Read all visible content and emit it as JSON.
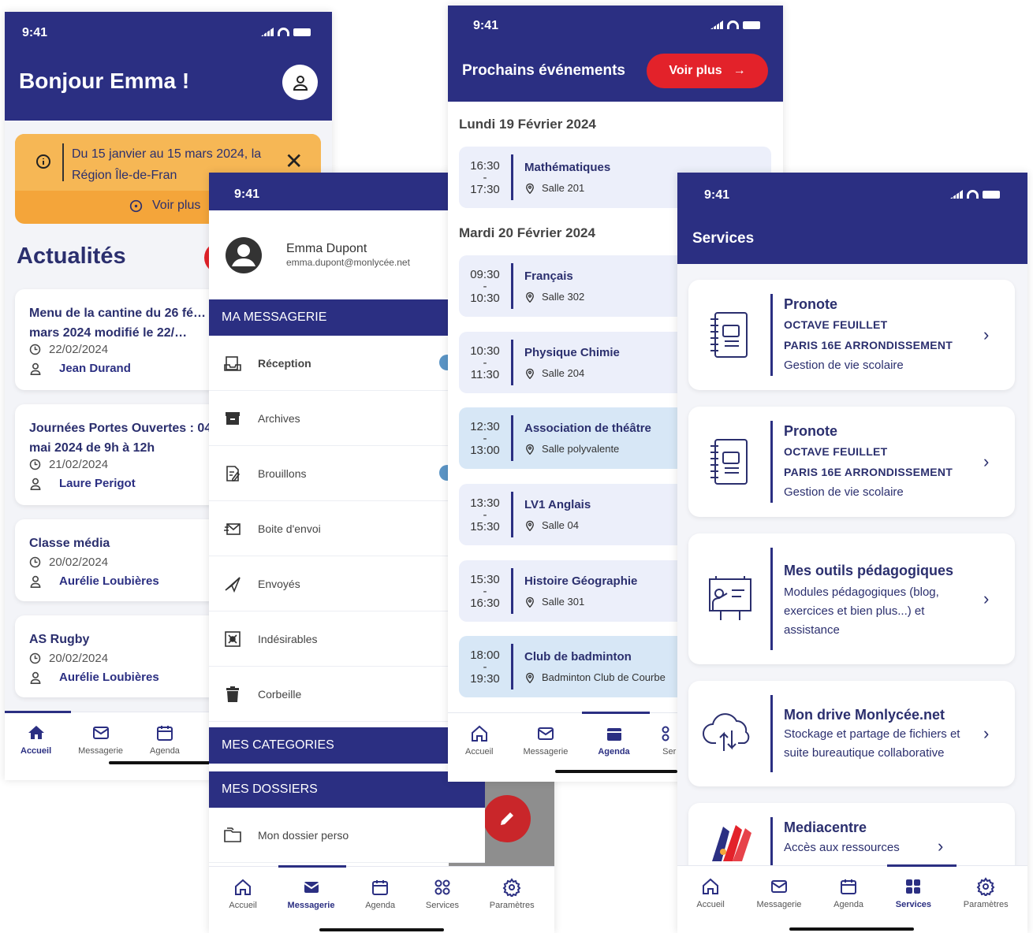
{
  "status": {
    "time": "9:41"
  },
  "home": {
    "greeting": "Bonjour Emma !",
    "banner": {
      "text": "Du 15 janvier au 15 mars 2024, la Région Île-de-Fran",
      "link": "Voir plus"
    },
    "section_title": "Actualités",
    "news": [
      {
        "title": "Menu de la cantine du 26 fé… mars 2024 modifié le 22/…",
        "date": "22/02/2024",
        "author": "Jean Durand"
      },
      {
        "title": "Journées Portes Ouvertes : 04 mai 2024 de 9h à 12h",
        "date": "21/02/2024",
        "author": "Laure Perigot"
      },
      {
        "title": "Classe média",
        "date": "20/02/2024",
        "author": "Aurélie Loubières"
      },
      {
        "title": "AS Rugby",
        "date": "20/02/2024",
        "author": "Aurélie Loubières"
      }
    ],
    "tabs": [
      "Accueil",
      "Messagerie",
      "Agenda"
    ]
  },
  "mail": {
    "user_name": "Emma Dupont",
    "user_email": "emma.dupont@monlycée.net",
    "section_inbox": "MA MESSAGERIE",
    "folders": [
      "Réception",
      "Archives",
      "Brouillons",
      "Boite d'envoi",
      "Envoyés",
      "Indésirables",
      "Corbeille"
    ],
    "section_categories": "MES CATEGORIES",
    "section_folders": "MES DOSSIERS",
    "personal_folder": "Mon dossier perso",
    "tabs": [
      "Accueil",
      "Messagerie",
      "Agenda",
      "Services",
      "Paramètres"
    ]
  },
  "agenda": {
    "title": "Prochains événements",
    "more_button": "Voir plus",
    "day1": "Lundi 19 Février 2024",
    "day2": "Mardi 20 Février 2024",
    "events": [
      {
        "start": "16:30",
        "end": "17:30",
        "title": "Mathématiques",
        "place": "Salle 201"
      },
      {
        "start": "09:30",
        "end": "10:30",
        "title": "Français",
        "place": "Salle 302"
      },
      {
        "start": "10:30",
        "end": "11:30",
        "title": "Physique Chimie",
        "place": "Salle 204"
      },
      {
        "start": "12:30",
        "end": "13:00",
        "title": "Association de théâtre",
        "place": "Salle polyvalente"
      },
      {
        "start": "13:30",
        "end": "15:30",
        "title": "LV1 Anglais",
        "place": "Salle 04"
      },
      {
        "start": "15:30",
        "end": "16:30",
        "title": "Histoire Géographie",
        "place": "Salle 301"
      },
      {
        "start": "18:00",
        "end": "19:30",
        "title": "Club de badminton",
        "place": "Badminton Club de Courbe"
      }
    ],
    "tabs": [
      "Accueil",
      "Messagerie",
      "Agenda",
      "Ser"
    ]
  },
  "services": {
    "title": "Services",
    "items": [
      {
        "name": "Pronote",
        "line1": "OCTAVE FEUILLET",
        "line2": "PARIS 16E ARRONDISSEMENT",
        "desc": "Gestion de vie scolaire"
      },
      {
        "name": "Pronote",
        "line1": "OCTAVE FEUILLET",
        "line2": "PARIS 16E ARRONDISSEMENT",
        "desc": "Gestion de vie scolaire"
      },
      {
        "name": "Mes outils pédagogiques",
        "desc": "Modules pédagogiques (blog, exercices et bien plus...) et assistance"
      },
      {
        "name": "Mon drive Monlycée.net",
        "desc": "Stockage et partage de fichiers et suite bureautique collaborative"
      },
      {
        "name": "Mediacentre",
        "desc": "Accès aux ressources"
      }
    ],
    "tabs": [
      "Accueil",
      "Messagerie",
      "Agenda",
      "Services",
      "Paramètres"
    ]
  },
  "colors": {
    "navy": "#2b2f82",
    "accent_red": "#e3222a",
    "banner_orange": "#f4a53a"
  }
}
